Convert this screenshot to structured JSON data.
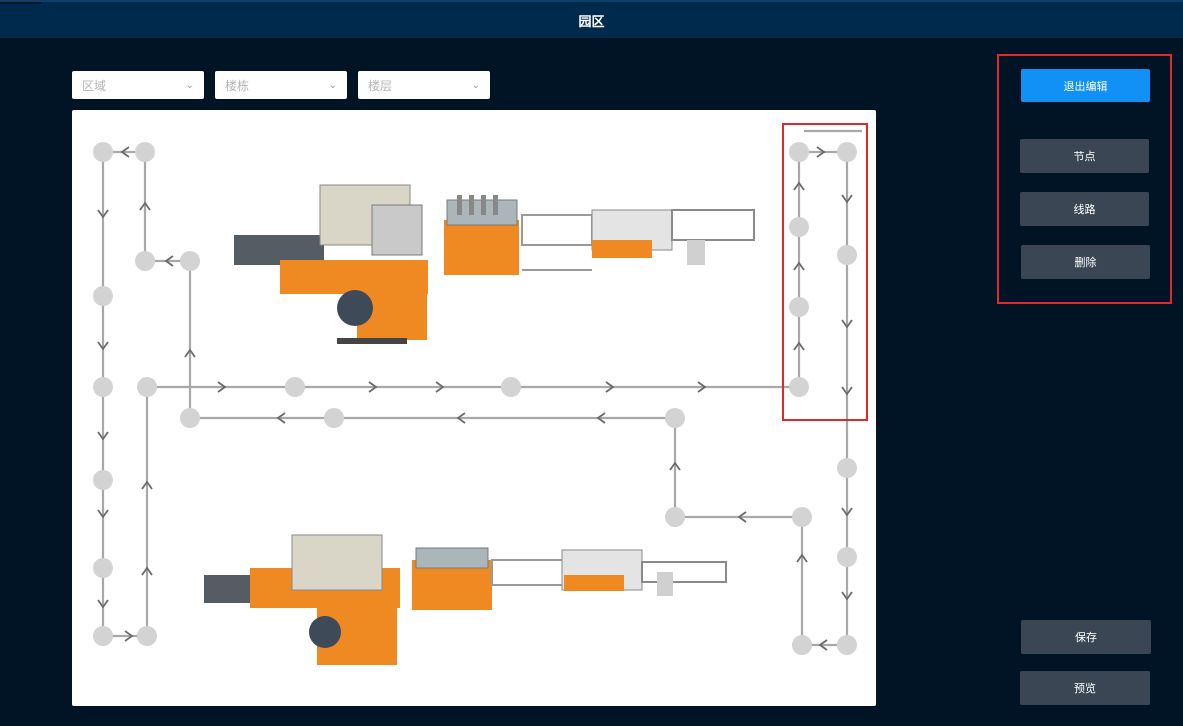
{
  "header": {
    "title": "园区"
  },
  "filters": [
    {
      "placeholder": "区域"
    },
    {
      "placeholder": "楼栋"
    },
    {
      "placeholder": "楼层"
    }
  ],
  "toolbar": {
    "exit_edit_label": "退出编辑",
    "node_label": "节点",
    "line_label": "线路",
    "delete_label": "删除"
  },
  "actions": {
    "save_label": "保存",
    "preview_label": "预览"
  },
  "colors": {
    "background": "#001426",
    "header": "#002a4d",
    "primary": "#1190f5",
    "dark_button": "#3a4653",
    "highlight": "#e02a2a",
    "node": "#d3d3d3",
    "path": "#a8a8a8",
    "machine_orange": "#ef8a22"
  },
  "icons": {
    "dropdown": "chevron-down-icon",
    "arrow": "path-arrow-icon"
  }
}
